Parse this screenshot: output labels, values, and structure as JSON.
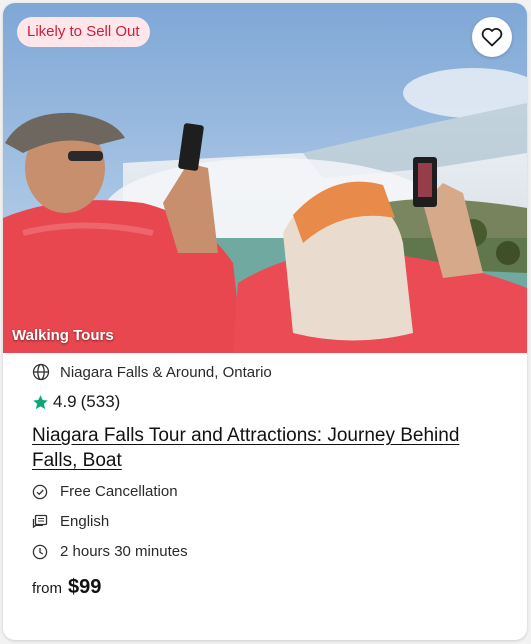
{
  "badge": {
    "label": "Likely to Sell Out"
  },
  "hero": {
    "category": "Walking Tours"
  },
  "card": {
    "location": "Niagara Falls & Around, Ontario",
    "rating": {
      "score": "4.9",
      "count": "(533)",
      "star_color": "#0ca678"
    },
    "title": "Niagara Falls Tour and Attractions: Journey Behind Falls, Boat",
    "features": [
      {
        "icon": "check-circle-icon",
        "label": "Free Cancellation"
      },
      {
        "icon": "language-icon",
        "label": "English"
      },
      {
        "icon": "clock-icon",
        "label": "2 hours 30 minutes"
      }
    ],
    "price": {
      "prefix": "from",
      "amount": "$99"
    }
  },
  "colors": {
    "badge_text": "#d21c3c",
    "badge_bg": "#fde7ea"
  }
}
